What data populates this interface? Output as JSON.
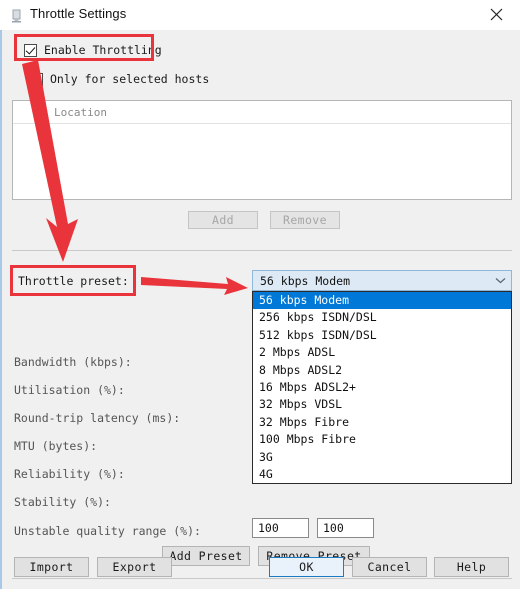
{
  "window": {
    "title": "Throttle Settings",
    "icon": "app-icon",
    "close_icon": "close-icon"
  },
  "throttle": {
    "enable_label": "Enable Throttling",
    "enable_checked": true,
    "only_selected_label": "Only for selected hosts",
    "only_selected_checked": false
  },
  "hosts": {
    "column_header": "Location",
    "rows": [],
    "add_label": "Add",
    "remove_label": "Remove",
    "add_enabled": false,
    "remove_enabled": false
  },
  "preset": {
    "label": "Throttle preset:",
    "selected": "56 kbps Modem",
    "dropdown_open": true,
    "options": [
      "56 kbps Modem",
      "256 kbps ISDN/DSL",
      "512 kbps ISDN/DSL",
      "2 Mbps ADSL",
      "8 Mbps ADSL2",
      "16 Mbps ADSL2+",
      "32 Mbps VDSL",
      "32 Mbps Fibre",
      "100 Mbps Fibre",
      "3G",
      "4G"
    ],
    "chevron_icon": "chevron-down-icon"
  },
  "fields": [
    {
      "label": "Bandwidth (kbps):",
      "value": ""
    },
    {
      "label": "Utilisation (%):",
      "value": ""
    },
    {
      "label": "Round-trip latency (ms):",
      "value": ""
    },
    {
      "label": "MTU (bytes):",
      "value": ""
    },
    {
      "label": "Reliability (%):",
      "value": ""
    },
    {
      "label": "Stability (%):",
      "value": ""
    }
  ],
  "unstable": {
    "label": "Unstable quality range (%):",
    "min_value": "100",
    "max_value": "100"
  },
  "preset_buttons": {
    "add_label": "Add Preset",
    "remove_label": "Remove Preset"
  },
  "footer": {
    "import_label": "Import",
    "export_label": "Export",
    "ok_label": "OK",
    "cancel_label": "Cancel",
    "help_label": "Help"
  },
  "annotations": {
    "accent_color": "#e8343a",
    "box_enable_throttling": "highlight-enable-throttling",
    "box_throttle_preset": "highlight-throttle-preset",
    "arrow_down": "arrow-to-throttle-preset",
    "arrow_right": "arrow-to-preset-dropdown"
  }
}
